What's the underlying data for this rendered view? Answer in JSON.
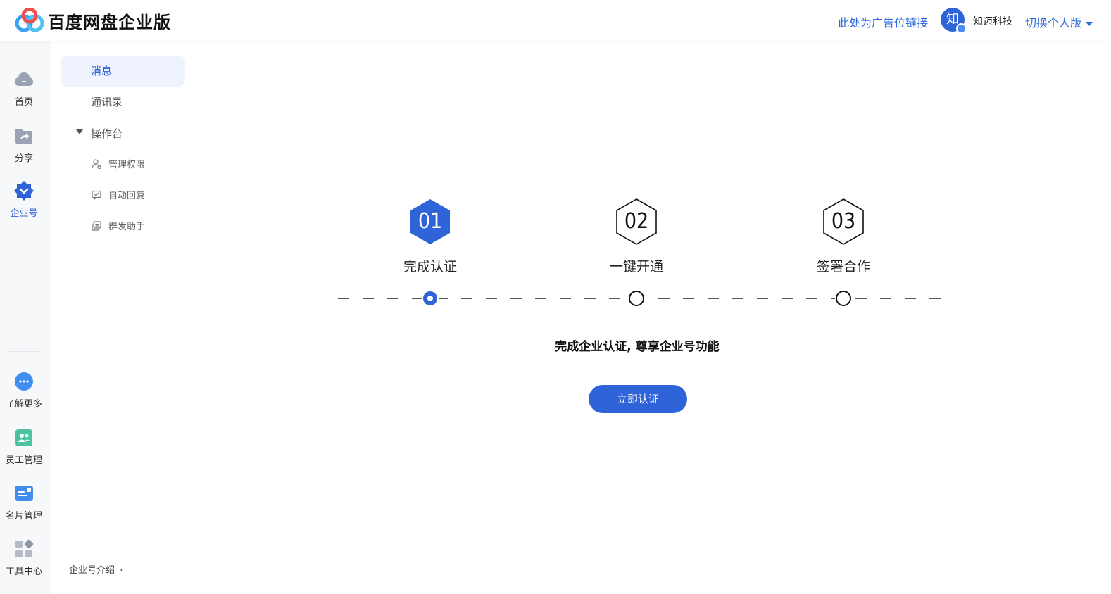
{
  "header": {
    "brand": "百度网盘企业版",
    "ad_link": "此处为广告位链接",
    "avatar_char": "知",
    "company": "知迈科技",
    "switch_label": "切换个人版"
  },
  "rail": {
    "items": [
      {
        "label": "首页",
        "icon": "cloud-icon"
      },
      {
        "label": "分享",
        "icon": "share-folder-icon"
      },
      {
        "label": "企业号",
        "icon": "enterprise-badge-icon",
        "active": true
      },
      {
        "label": "了解更多",
        "icon": "more-chat-icon"
      },
      {
        "label": "员工管理",
        "icon": "staff-icon"
      },
      {
        "label": "名片管理",
        "icon": "card-icon"
      },
      {
        "label": "工具中心",
        "icon": "tools-grid-icon"
      }
    ]
  },
  "sidebar": {
    "messages": "消息",
    "contacts": "通讯录",
    "console": "操作台",
    "sub_items": [
      "管理权限",
      "自动回复",
      "群发助手"
    ],
    "intro": "企业号介绍"
  },
  "steps": [
    {
      "number": "01",
      "label": "完成认证",
      "state": "active"
    },
    {
      "number": "02",
      "label": "一键开通",
      "state": "pending"
    },
    {
      "number": "03",
      "label": "签署合作",
      "state": "pending"
    }
  ],
  "main": {
    "headline": "完成企业认证, 尊享企业号功能",
    "cta": "立即认证"
  },
  "colors": {
    "accent": "#2f63d8",
    "link": "#2f6bdc",
    "active_bg": "#eef3fd"
  }
}
